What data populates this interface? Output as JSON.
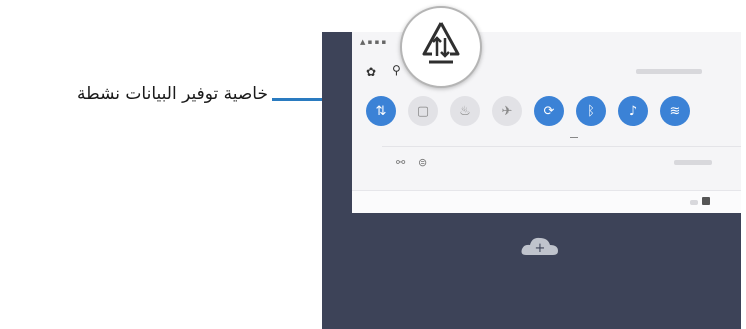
{
  "callout": {
    "label": "خاصية توفير البيانات نشطة"
  },
  "icons": {
    "badge": "data-saver-icon",
    "settings": "gear-icon",
    "search": "search-icon",
    "add": "add-cloud-icon"
  },
  "colors": {
    "accent": "#2a7bc0",
    "tile_on": "#3b82d6",
    "wallpaper": "#3d4358"
  },
  "quick_panel": {
    "tiles": [
      {
        "name": "data-saver-tile",
        "glyph": "⇅",
        "on": true
      },
      {
        "name": "screen-tile",
        "glyph": "▢",
        "on": false
      },
      {
        "name": "flashlight-tile",
        "glyph": "♨",
        "on": false
      },
      {
        "name": "airplane-tile",
        "glyph": "✈",
        "on": false
      },
      {
        "name": "auto-rotate-tile",
        "glyph": "⟳",
        "on": true
      },
      {
        "name": "bluetooth-tile",
        "glyph": "ᛒ",
        "on": true
      },
      {
        "name": "sound-tile",
        "glyph": "♪",
        "on": true
      },
      {
        "name": "wifi-tile",
        "glyph": "≋",
        "on": true
      }
    ],
    "extra_row": [
      "⚯",
      "⊜"
    ],
    "cloud_plus": "+"
  }
}
